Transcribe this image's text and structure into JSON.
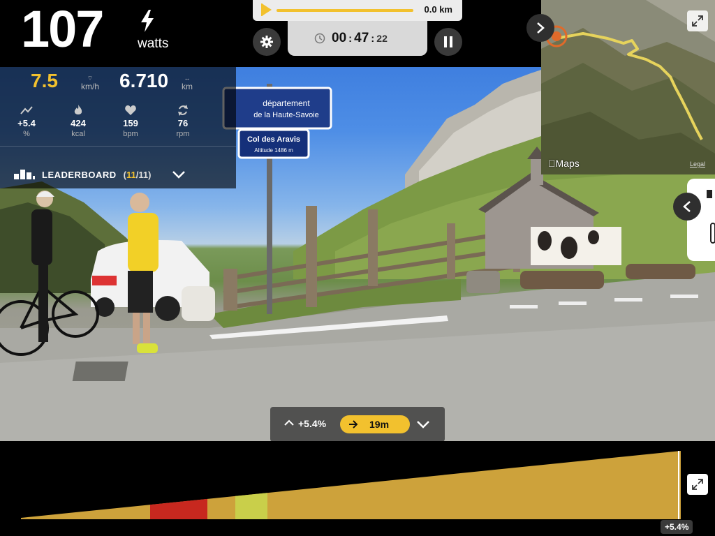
{
  "power": {
    "value": "107",
    "unit": "watts",
    "icon": "bolt-icon"
  },
  "speed": {
    "value": "7.5",
    "unit": "km/h",
    "color": "#f2c12e"
  },
  "distance": {
    "value": "6.710",
    "unit": "km"
  },
  "metrics": [
    {
      "icon": "grade-icon",
      "value": "+5.4",
      "unit": "%"
    },
    {
      "icon": "flame-icon",
      "value": "424",
      "unit": "kcal"
    },
    {
      "icon": "heart-icon",
      "value": "159",
      "unit": "bpm"
    },
    {
      "icon": "cadence-icon",
      "value": "76",
      "unit": "rpm"
    }
  ],
  "leaderboard": {
    "label": "LEADERBOARD",
    "open": "(",
    "current": "11",
    "total": "/11)"
  },
  "progress": {
    "distance_label": "0.0 km"
  },
  "timer": {
    "hours": "00",
    "minutes": "47",
    "seconds": "22",
    "sep": ":"
  },
  "map": {
    "attribution": "Maps",
    "legal": "Legal"
  },
  "grade_pill": {
    "grade": "+5.4%",
    "next": "19m"
  },
  "elevation": {
    "current_grade": "+5.4%"
  },
  "scene_signs": {
    "top_line1": "département",
    "top_line2": "de la Haute-Savoie",
    "col_line1": "Col des Aravis",
    "col_line2": "Altitude 1486 m"
  },
  "colors": {
    "accent": "#f2c12e",
    "profile_base": "#cda23b",
    "profile_red": "#c7281f",
    "profile_light": "#c9cf4a"
  }
}
